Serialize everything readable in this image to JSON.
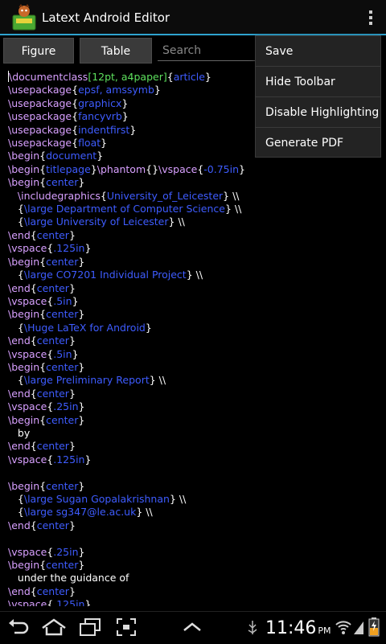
{
  "app": {
    "title": "Latext Android Editor"
  },
  "toolbar": {
    "figure_label": "Figure",
    "table_label": "Table",
    "search_placeholder": "Search"
  },
  "menu": {
    "items": [
      "Save",
      "Hide Toolbar",
      "Disable Highlighting",
      "Generate PDF"
    ]
  },
  "status": {
    "time": "11:46",
    "ampm": "PM"
  },
  "colors": {
    "accent": "#2fa3cf",
    "command": "#d8a0ff",
    "argument": "#3e5cff",
    "option": "#5de05d"
  },
  "icons": {
    "app": "latex-app-icon",
    "overflow": "overflow-menu-icon",
    "back": "back-icon",
    "home": "home-icon",
    "recents": "recent-apps-icon",
    "screenshot": "screenshot-icon",
    "up": "chevron-up-icon",
    "usb": "usb-icon",
    "wifi": "wifi-icon",
    "signal": "signal-icon",
    "battery": "battery-icon"
  },
  "editor": {
    "lines": [
      [
        [
          "cmd",
          "\\documentclass"
        ],
        [
          "opt",
          "[12pt, a4paper]"
        ],
        [
          "txt",
          "{"
        ],
        [
          "arg",
          "article"
        ],
        [
          "txt",
          "}"
        ]
      ],
      [
        [
          "cmd",
          "\\usepackage"
        ],
        [
          "txt",
          "{"
        ],
        [
          "arg",
          "epsf, amssymb"
        ],
        [
          "txt",
          "}"
        ]
      ],
      [
        [
          "cmd",
          "\\usepackage"
        ],
        [
          "txt",
          "{"
        ],
        [
          "arg",
          "graphicx"
        ],
        [
          "txt",
          "}"
        ]
      ],
      [
        [
          "cmd",
          "\\usepackage"
        ],
        [
          "txt",
          "{"
        ],
        [
          "arg",
          "fancyvrb"
        ],
        [
          "txt",
          "}"
        ]
      ],
      [
        [
          "cmd",
          "\\usepackage"
        ],
        [
          "txt",
          "{"
        ],
        [
          "arg",
          "indentfirst"
        ],
        [
          "txt",
          "}"
        ]
      ],
      [
        [
          "cmd",
          "\\usepackage"
        ],
        [
          "txt",
          "{"
        ],
        [
          "arg",
          "float"
        ],
        [
          "txt",
          "}"
        ]
      ],
      [
        [
          "cmd",
          "\\begin"
        ],
        [
          "txt",
          "{"
        ],
        [
          "arg",
          "document"
        ],
        [
          "txt",
          "}"
        ]
      ],
      [
        [
          "cmd",
          "\\begin"
        ],
        [
          "txt",
          "{"
        ],
        [
          "arg",
          "titlepage"
        ],
        [
          "txt",
          "}"
        ],
        [
          "cmd",
          "\\phantom"
        ],
        [
          "txt",
          "{}"
        ],
        [
          "cmd",
          "\\vspace"
        ],
        [
          "txt",
          "{"
        ],
        [
          "arg",
          "-0.75in"
        ],
        [
          "txt",
          "}"
        ]
      ],
      [
        [
          "cmd",
          "\\begin"
        ],
        [
          "txt",
          "{"
        ],
        [
          "arg",
          "center"
        ],
        [
          "txt",
          "}"
        ]
      ],
      [
        [
          "txt",
          "   "
        ],
        [
          "cmd",
          "\\includegraphics"
        ],
        [
          "txt",
          "{"
        ],
        [
          "arg",
          "University_of_Leicester"
        ],
        [
          "txt",
          "} \\\\"
        ]
      ],
      [
        [
          "txt",
          "   {"
        ],
        [
          "arg",
          "\\large Department of Computer Science"
        ],
        [
          "txt",
          "} \\\\"
        ]
      ],
      [
        [
          "txt",
          "   {"
        ],
        [
          "arg",
          "\\large University of Leicester"
        ],
        [
          "txt",
          "} \\\\"
        ]
      ],
      [
        [
          "cmd",
          "\\end"
        ],
        [
          "txt",
          "{"
        ],
        [
          "arg",
          "center"
        ],
        [
          "txt",
          "}"
        ]
      ],
      [
        [
          "cmd",
          "\\vspace"
        ],
        [
          "txt",
          "{"
        ],
        [
          "arg",
          ".125in"
        ],
        [
          "txt",
          "}"
        ]
      ],
      [
        [
          "cmd",
          "\\begin"
        ],
        [
          "txt",
          "{"
        ],
        [
          "arg",
          "center"
        ],
        [
          "txt",
          "}"
        ]
      ],
      [
        [
          "txt",
          "   {"
        ],
        [
          "arg",
          "\\large CO7201 Individual Project"
        ],
        [
          "txt",
          "} \\\\"
        ]
      ],
      [
        [
          "cmd",
          "\\end"
        ],
        [
          "txt",
          "{"
        ],
        [
          "arg",
          "center"
        ],
        [
          "txt",
          "}"
        ]
      ],
      [
        [
          "cmd",
          "\\vspace"
        ],
        [
          "txt",
          "{"
        ],
        [
          "arg",
          ".5in"
        ],
        [
          "txt",
          "}"
        ]
      ],
      [
        [
          "cmd",
          "\\begin"
        ],
        [
          "txt",
          "{"
        ],
        [
          "arg",
          "center"
        ],
        [
          "txt",
          "}"
        ]
      ],
      [
        [
          "txt",
          "   {"
        ],
        [
          "arg",
          "\\Huge LaTeX for Android"
        ],
        [
          "txt",
          "}"
        ]
      ],
      [
        [
          "cmd",
          "\\end"
        ],
        [
          "txt",
          "{"
        ],
        [
          "arg",
          "center"
        ],
        [
          "txt",
          "}"
        ]
      ],
      [
        [
          "cmd",
          "\\vspace"
        ],
        [
          "txt",
          "{"
        ],
        [
          "arg",
          ".5in"
        ],
        [
          "txt",
          "}"
        ]
      ],
      [
        [
          "cmd",
          "\\begin"
        ],
        [
          "txt",
          "{"
        ],
        [
          "arg",
          "center"
        ],
        [
          "txt",
          "}"
        ]
      ],
      [
        [
          "txt",
          "   {"
        ],
        [
          "arg",
          "\\large Preliminary Report"
        ],
        [
          "txt",
          "} \\\\"
        ]
      ],
      [
        [
          "cmd",
          "\\end"
        ],
        [
          "txt",
          "{"
        ],
        [
          "arg",
          "center"
        ],
        [
          "txt",
          "}"
        ]
      ],
      [
        [
          "cmd",
          "\\vspace"
        ],
        [
          "txt",
          "{"
        ],
        [
          "arg",
          ".25in"
        ],
        [
          "txt",
          "}"
        ]
      ],
      [
        [
          "cmd",
          "\\begin"
        ],
        [
          "txt",
          "{"
        ],
        [
          "arg",
          "center"
        ],
        [
          "txt",
          "}"
        ]
      ],
      [
        [
          "txt",
          "   by"
        ]
      ],
      [
        [
          "cmd",
          "\\end"
        ],
        [
          "txt",
          "{"
        ],
        [
          "arg",
          "center"
        ],
        [
          "txt",
          "}"
        ]
      ],
      [
        [
          "cmd",
          "\\vspace"
        ],
        [
          "txt",
          "{"
        ],
        [
          "arg",
          ".125in"
        ],
        [
          "txt",
          "}"
        ]
      ],
      [],
      [
        [
          "cmd",
          "\\begin"
        ],
        [
          "txt",
          "{"
        ],
        [
          "arg",
          "center"
        ],
        [
          "txt",
          "}"
        ]
      ],
      [
        [
          "txt",
          "   {"
        ],
        [
          "arg",
          "\\large Sugan Gopalakrishnan"
        ],
        [
          "txt",
          "} \\\\"
        ]
      ],
      [
        [
          "txt",
          "   {"
        ],
        [
          "arg",
          "\\large sg347@le.ac.uk"
        ],
        [
          "txt",
          "} \\\\"
        ]
      ],
      [
        [
          "cmd",
          "\\end"
        ],
        [
          "txt",
          "{"
        ],
        [
          "arg",
          "center"
        ],
        [
          "txt",
          "}"
        ]
      ],
      [],
      [
        [
          "cmd",
          "\\vspace"
        ],
        [
          "txt",
          "{"
        ],
        [
          "arg",
          ".25in"
        ],
        [
          "txt",
          "}"
        ]
      ],
      [
        [
          "cmd",
          "\\begin"
        ],
        [
          "txt",
          "{"
        ],
        [
          "arg",
          "center"
        ],
        [
          "txt",
          "}"
        ]
      ],
      [
        [
          "txt",
          "   under the guidance of"
        ]
      ],
      [
        [
          "cmd",
          "\\end"
        ],
        [
          "txt",
          "{"
        ],
        [
          "arg",
          "center"
        ],
        [
          "txt",
          "}"
        ]
      ],
      [
        [
          "cmd",
          "\\vspace"
        ],
        [
          "txt",
          "{"
        ],
        [
          "arg",
          ".125in"
        ],
        [
          "txt",
          "}"
        ]
      ]
    ]
  }
}
